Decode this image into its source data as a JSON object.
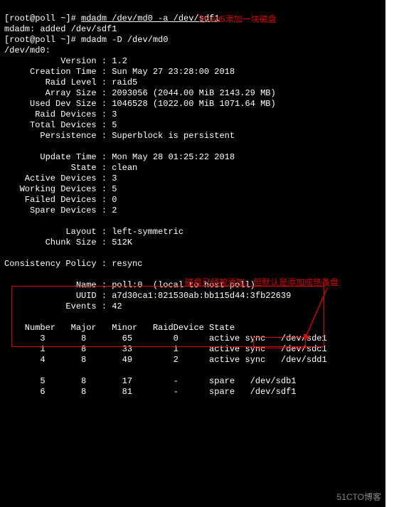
{
  "prompt1_user": "[root@poll ~]# ",
  "cmd1": "mdadm /dev/md0 -a /dev/sdf1",
  "line_added": "mdadm: added /dev/sdf1",
  "annot1": "为raid5添加一块磁盘",
  "prompt2_user": "[root@poll ~]# ",
  "cmd2": "mdadm -D /dev/md0",
  "line_dev": "/dev/md0:",
  "kv": {
    "version_l": "           Version : ",
    "version_v": "1.2",
    "ctime_l": "     Creation Time : ",
    "ctime_v": "Sun May 27 23:28:00 2018",
    "rlevel_l": "        Raid Level : ",
    "rlevel_v": "raid5",
    "asize_l": "        Array Size : ",
    "asize_v": "2093056 (2044.00 MiB 2143.29 MB)",
    "usize_l": "     Used Dev Size : ",
    "usize_v": "1046528 (1022.00 MiB 1071.64 MB)",
    "rdev_l": "      Raid Devices : ",
    "rdev_v": "3",
    "tdev_l": "     Total Devices : ",
    "tdev_v": "5",
    "pers_l": "       Persistence : ",
    "pers_v": "Superblock is persistent",
    "utime_l": "       Update Time : ",
    "utime_v": "Mon May 28 01:25:22 2018",
    "state_l": "             State : ",
    "state_v": "clean",
    "adev_l": "    Active Devices : ",
    "adev_v": "3",
    "wdev_l": "   Working Devices : ",
    "wdev_v": "5",
    "fdev_l": "    Failed Devices : ",
    "fdev_v": "0",
    "sdev_l": "     Spare Devices : ",
    "sdev_v": "2",
    "layout_l": "            Layout : ",
    "layout_v": "left-symmetric",
    "chunk_l": "        Chunk Size : ",
    "chunk_v": "512K",
    "cpol_l": "Consistency Policy : ",
    "cpol_v": "resync",
    "name_l": "              Name : ",
    "name_v": "poll:0  (local to host poll)",
    "uuid_l": "              UUID : ",
    "uuid_v": "a7d30ca1:821530ab:bb115d44:3fb22639",
    "events_l": "            Events : ",
    "events_v": "42"
  },
  "annot2": "磁盘已经被添加，但默认是添加成热备盘",
  "table_header": "    Number   Major   Minor   RaidDevice State",
  "rows": [
    "       3       8       65        0      active sync   /dev/sde1",
    "       1       8       33        1      active sync   /dev/sdc1",
    "       4       8       49        2      active sync   /dev/sdd1",
    "",
    "       5       8       17        -      spare   /dev/sdb1",
    "       6       8       81        -      spare   /dev/sdf1"
  ],
  "watermark": "51CTO博客"
}
